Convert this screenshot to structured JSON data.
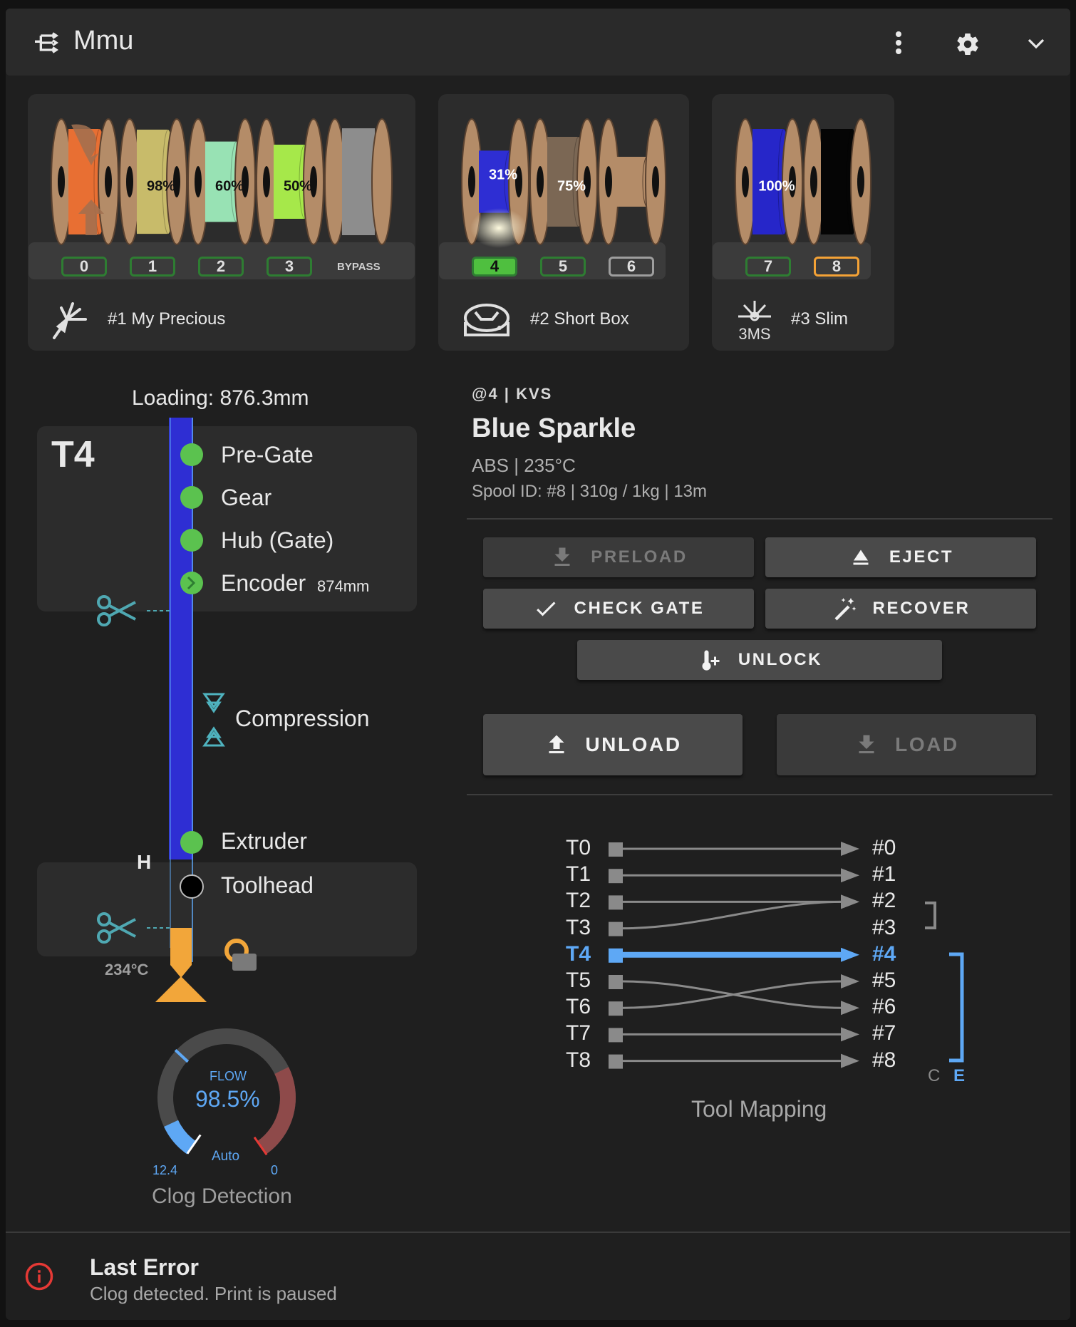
{
  "header": {
    "title": "Mmu",
    "menu_icon": "dots-vertical-icon",
    "settings_icon": "gear-icon",
    "collapse_icon": "chevron-down-icon",
    "app_icon": "mmu-tree-icon"
  },
  "units": [
    {
      "name": "#1 My Precious",
      "logo": "feather-logo-icon",
      "bypass_label": "BYPASS",
      "gates": [
        {
          "label": "0",
          "color": "#e86f33",
          "percent": "",
          "status": "ok"
        },
        {
          "label": "1",
          "color": "#c8bb6a",
          "percent": "98%",
          "status": "ok"
        },
        {
          "label": "2",
          "color": "#98e2b4",
          "percent": "60%",
          "status": "ok"
        },
        {
          "label": "3",
          "color": "#a6e84a",
          "percent": "50%",
          "status": "ok"
        }
      ]
    },
    {
      "name": "#2 Short Box",
      "logo": "turtle-box-logo-icon",
      "gates": [
        {
          "label": "4",
          "color": "#2e2ed3",
          "percent": "31%",
          "status": "selected"
        },
        {
          "label": "5",
          "color": "#7b6754",
          "percent": "75%",
          "status": "ok"
        },
        {
          "label": "6",
          "color": "",
          "percent": "",
          "status": "empty"
        }
      ]
    },
    {
      "name": "#3 Slim",
      "logo": "3ms-logo-icon",
      "gates": [
        {
          "label": "7",
          "color": "#2626c9",
          "percent": "100%",
          "status": "ok"
        },
        {
          "label": "8",
          "color": "#050505",
          "percent": "",
          "status": "warning"
        }
      ]
    }
  ],
  "filament_path": {
    "loading_label": "Loading: 876.3mm",
    "tool": "T4",
    "filament_color": "#2e2ed3",
    "steps": [
      {
        "label": "Pre-Gate",
        "state": "ok"
      },
      {
        "label": "Gear",
        "state": "ok"
      },
      {
        "label": "Hub (Gate)",
        "state": "ok"
      },
      {
        "label": "Encoder",
        "state": "ok",
        "extra": "874mm"
      },
      {
        "label": "Compression",
        "state": "sensor"
      },
      {
        "label": "Extruder",
        "state": "ok"
      },
      {
        "label": "Toolhead",
        "state": "empty"
      }
    ],
    "h_label": "H",
    "nozzle_temp": "234°C"
  },
  "clog": {
    "flow_label": "FLOW",
    "flow_value": "98.5%",
    "mode": "Auto",
    "min_label": "12.4",
    "max_label": "0",
    "title": "Clog Detection",
    "flow_fraction": 0.985,
    "headroom_fraction": 0.28
  },
  "spool": {
    "subtitle": "@4 | KVS",
    "name": "Blue Sparkle",
    "material": "ABS | 235°C",
    "details": "Spool ID: #8 | 310g / 1kg | 13m"
  },
  "actions": {
    "preload": "PRELOAD",
    "eject": "EJECT",
    "check_gate": "CHECK GATE",
    "recover": "RECOVER",
    "unlock": "UNLOCK",
    "unload": "UNLOAD",
    "load": "LOAD"
  },
  "tool_mapping": {
    "title": "Tool Mapping",
    "tools": [
      "T0",
      "T1",
      "T2",
      "T3",
      "T4",
      "T5",
      "T6",
      "T7",
      "T8"
    ],
    "gates": [
      "#0",
      "#1",
      "#2",
      "#3",
      "#4",
      "#5",
      "#6",
      "#7",
      "#8"
    ],
    "map": [
      0,
      1,
      2,
      2,
      4,
      6,
      5,
      7,
      8
    ],
    "active_tool": 4,
    "c_label": "C",
    "e_label": "E"
  },
  "error": {
    "title": "Last Error",
    "message": "Clog detected. Print is paused",
    "icon": "info-circle-icon"
  },
  "colors": {
    "accent": "#5ea8f5",
    "ok": "#5bc24f",
    "warning": "#f4a236",
    "error": "#e53935",
    "spool_body": "#b48c68"
  }
}
